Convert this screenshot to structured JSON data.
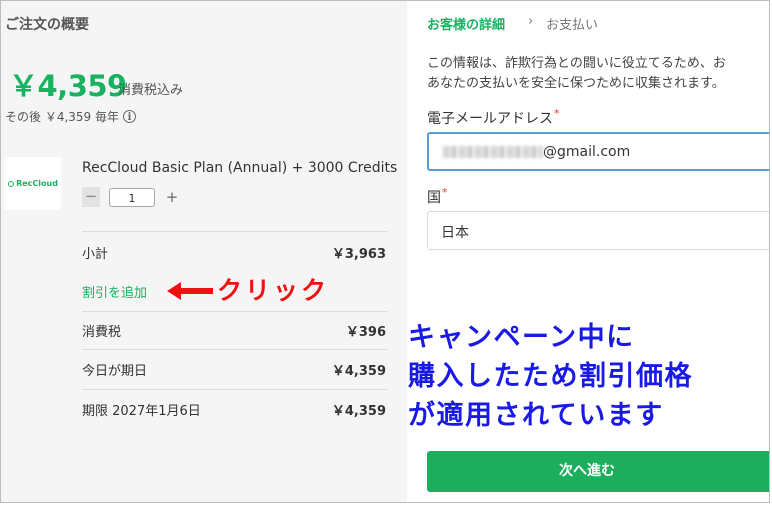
{
  "order": {
    "title": "ご注文の概要",
    "price": "￥4,359",
    "tax_included": "消費税込み",
    "renewal": "その後 ￥4,359 毎年",
    "info_icon": "info-circle-icon",
    "logo_text": "RecCloud",
    "product_name": "RecCloud Basic Plan (Annual) + 3000 Credits",
    "qty_minus": "−",
    "quantity": "1",
    "qty_plus": "+",
    "rows": [
      {
        "label": "小計",
        "value": "￥3,963"
      },
      {
        "label": "消費税",
        "value": "￥396"
      },
      {
        "label": "今日が期日",
        "value": "￥4,359"
      },
      {
        "label": "期限 2027年1月6日",
        "value": "￥4,359"
      }
    ],
    "discount_link": "割引を追加"
  },
  "annotations": {
    "click_text": "クリック",
    "campaign_lines": [
      "キャンペーン中に",
      "購入したため割引価格",
      "が適用されています"
    ],
    "arrow_color": "#ee1111",
    "campaign_color": "#1a1ae6"
  },
  "checkout": {
    "breadcrumb_current": "お客様の詳細",
    "breadcrumb_sep": "›",
    "breadcrumb_next": "お支払い",
    "info_lines": [
      "この情報は、詐欺行為との闘いに役立てるため、お",
      "あなたの支払いを安全に保つために収集されます。"
    ],
    "email_label": "電子メールアドレス",
    "email_suffix": "@gmail.com",
    "required_mark": "*",
    "country_label": "国",
    "country_value": "日本",
    "next_button": "次へ進む"
  },
  "colors": {
    "accent_green": "#19b260",
    "button_green": "#1cae5c",
    "focus_blue": "#5a9bd8"
  }
}
